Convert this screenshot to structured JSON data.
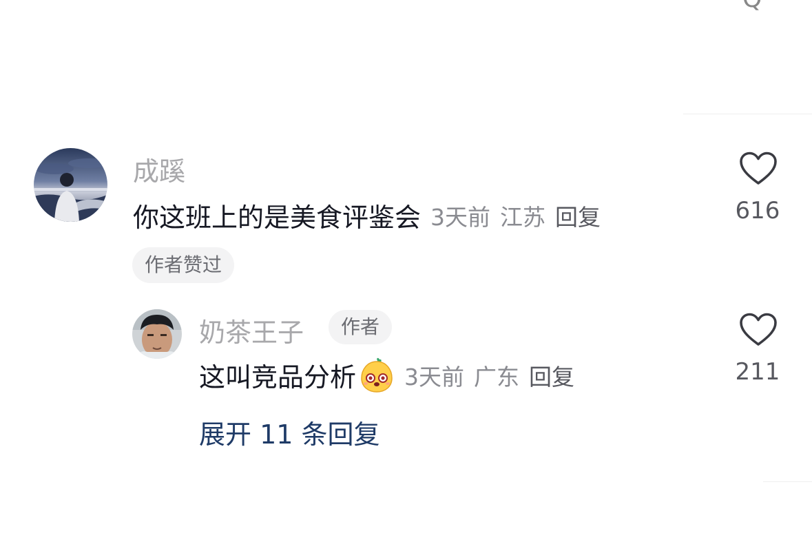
{
  "comment": {
    "username": "成蹊",
    "text": "你这班上的是美食评鉴会",
    "time": "3天前",
    "location": "江苏",
    "reply_label": "回复",
    "like_count": "616",
    "liked_by_author_badge": "作者赞过"
  },
  "reply": {
    "username": "奶茶王子",
    "author_tag": "作者",
    "text": "这叫竞品分析",
    "emoji": "cute-face-emoji",
    "time": "3天前",
    "location": "广东",
    "reply_label": "回复",
    "like_count": "211"
  },
  "expand_replies_label": "展开 11 条回复",
  "top_partial_glyph": "Q",
  "icons": {
    "like": "heart-outline-icon"
  },
  "colors": {
    "text_primary": "#161823",
    "text_secondary": "#a8a8ab",
    "meta": "#8a8b91",
    "expand_link": "#1f3b67",
    "badge_bg": "#f3f3f4"
  }
}
